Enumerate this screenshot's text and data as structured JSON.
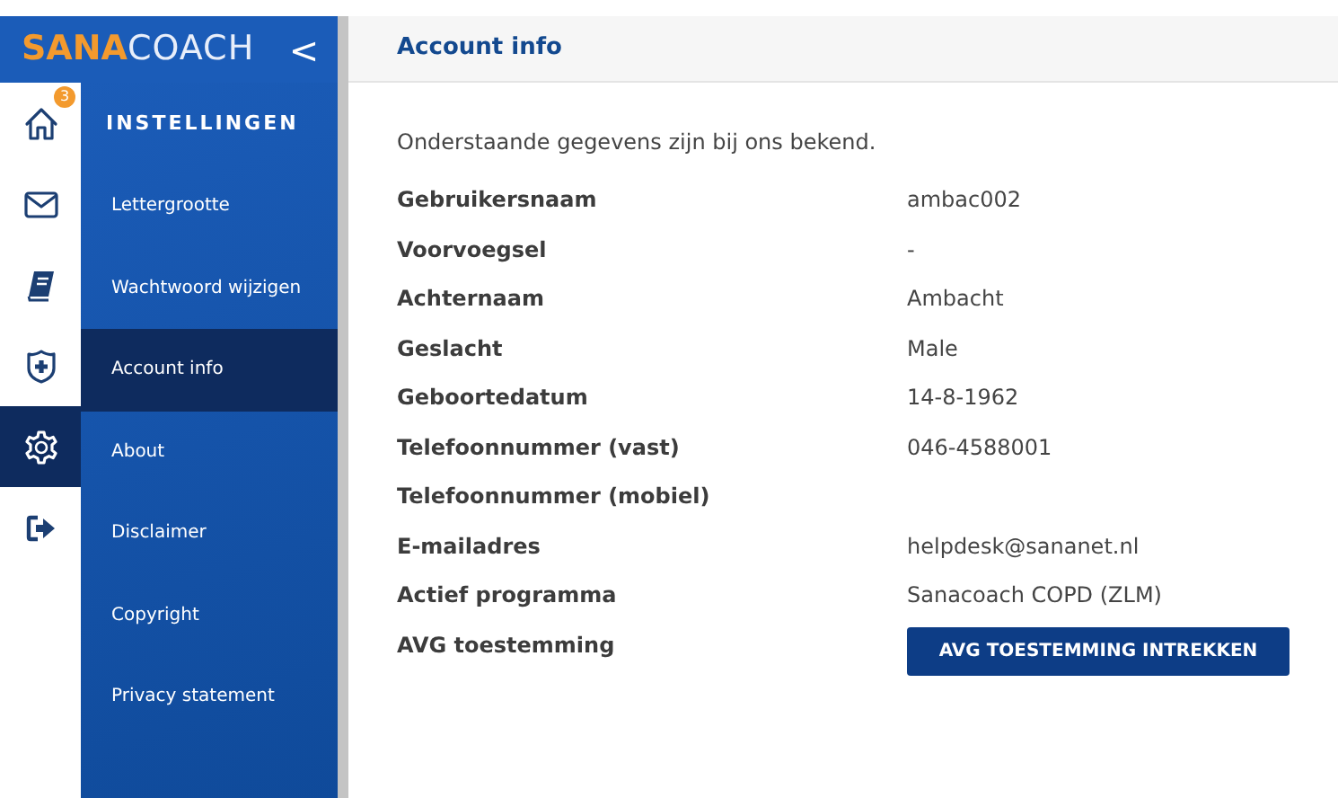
{
  "logo": {
    "brand_bold": "SANA",
    "brand_light": "COACH",
    "collapse": "<"
  },
  "icon_bar": [
    {
      "kind": "home",
      "selected": false,
      "badge": "3"
    },
    {
      "kind": "mail",
      "selected": false
    },
    {
      "kind": "book",
      "selected": false
    },
    {
      "kind": "shield",
      "selected": false
    },
    {
      "kind": "gear",
      "selected": true
    },
    {
      "kind": "logout",
      "selected": false
    }
  ],
  "submenu": {
    "heading": "INSTELLINGEN",
    "items": [
      {
        "label": "Lettergrootte",
        "selected": false
      },
      {
        "label": "Wachtwoord wijzigen",
        "selected": false
      },
      {
        "label": "Account info",
        "selected": true
      },
      {
        "label": "About",
        "selected": false
      },
      {
        "label": "Disclaimer",
        "selected": false
      },
      {
        "label": "Copyright",
        "selected": false
      },
      {
        "label": "Privacy statement",
        "selected": false
      }
    ]
  },
  "page": {
    "title": "Account info",
    "intro": "Onderstaande gegevens zijn bij ons bekend.",
    "fields": [
      {
        "kind": "text",
        "label": "Gebruikersnaam",
        "value": "ambac002"
      },
      {
        "kind": "text",
        "label": "Voorvoegsel",
        "value": "-"
      },
      {
        "kind": "text",
        "label": "Achternaam",
        "value": "Ambacht"
      },
      {
        "kind": "text",
        "label": "Geslacht",
        "value": "Male"
      },
      {
        "kind": "text",
        "label": "Geboortedatum",
        "value": "14-8-1962"
      },
      {
        "kind": "text",
        "label": "Telefoonnummer (vast)",
        "value": "046-4588001"
      },
      {
        "kind": "text",
        "label": "Telefoonnummer (mobiel)"
      },
      {
        "kind": "text",
        "label": "E-mailadres",
        "value": "helpdesk@sananet.nl"
      },
      {
        "kind": "text",
        "label": "Actief programma",
        "value": "Sanacoach COPD (ZLM)"
      },
      {
        "kind": "button",
        "label": "AVG toestemming",
        "value": "AVG TOESTEMMING INTREKKEN"
      }
    ]
  }
}
